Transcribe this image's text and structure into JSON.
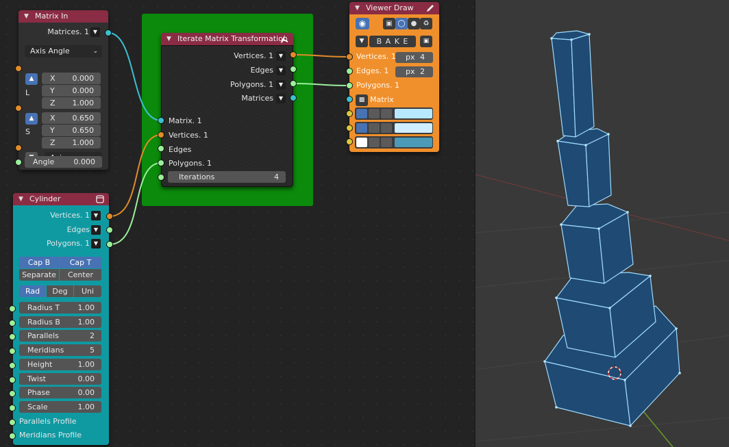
{
  "colors": {
    "link_orange": "#e08c2a",
    "link_green": "#9cf09c",
    "link_cyan": "#3cc0d0",
    "header_red": "#8a2c44",
    "cylinder_body": "#0f9aa2",
    "viewer_body": "#f0902c",
    "frame_green": "#0b8a0b",
    "selection_blue": "#4772b3",
    "mesh_face": "#1f4a73",
    "mesh_edge": "#9fdcff"
  },
  "matrix_in": {
    "title": "Matrix In",
    "out_matrices": "Matrices. 1",
    "mode": "Axis Angle",
    "loc_label": "L",
    "loc": [
      {
        "axis": "X",
        "value": "0.000"
      },
      {
        "axis": "Y",
        "value": "0.000"
      },
      {
        "axis": "Z",
        "value": "1.000"
      }
    ],
    "scale_label": "S",
    "scale": [
      {
        "axis": "X",
        "value": "0.650"
      },
      {
        "axis": "Y",
        "value": "0.650"
      },
      {
        "axis": "Z",
        "value": "1.000"
      }
    ],
    "axis_select": "Axis",
    "angle_label": "Angle",
    "angle_value": "0.000"
  },
  "iterate": {
    "title": "Iterate Matrix Transformation",
    "out_vertices": "Vertices. 1",
    "out_edges": "Edges",
    "out_polygons": "Polygons. 1",
    "out_matrices": "Matrices",
    "in_matrix": "Matrix. 1",
    "in_vertices": "Vertices. 1",
    "in_edges": "Edges",
    "in_polygons": "Polygons. 1",
    "iterations_label": "Iterations",
    "iterations_value": "4"
  },
  "viewer": {
    "title": "Viewer Draw",
    "bake": "B A K E",
    "in_vertices": "Vertices. 1",
    "in_edges": "Edges. 1",
    "in_polygons": "Polygons. 1",
    "in_matrix": "Matrix",
    "px_label": "px",
    "vert_size": "4",
    "edge_width": "2",
    "swatches": [
      "#b8e8ff",
      "#cfeeff",
      "#4a9ab8"
    ]
  },
  "cylinder": {
    "title": "Cylinder",
    "out_vertices": "Vertices. 1",
    "out_edges": "Edges",
    "out_polygons": "Polygons. 1",
    "cap_b": "Cap B",
    "cap_t": "Cap T",
    "separate": "Separate",
    "center": "Center",
    "units": [
      "Rad",
      "Deg",
      "Uni"
    ],
    "params": [
      {
        "label": "Radius T",
        "value": "1.00"
      },
      {
        "label": "Radius B",
        "value": "1.00"
      },
      {
        "label": "Parallels",
        "value": "2"
      },
      {
        "label": "Meridians",
        "value": "5"
      },
      {
        "label": "Height",
        "value": "1.00"
      },
      {
        "label": "Twist",
        "value": "0.00"
      },
      {
        "label": "Phase",
        "value": "0.00"
      },
      {
        "label": "Scale",
        "value": "1.00"
      }
    ],
    "parallels_profile": "Parallels Profile",
    "meridians_profile": "Meridians Profile"
  }
}
